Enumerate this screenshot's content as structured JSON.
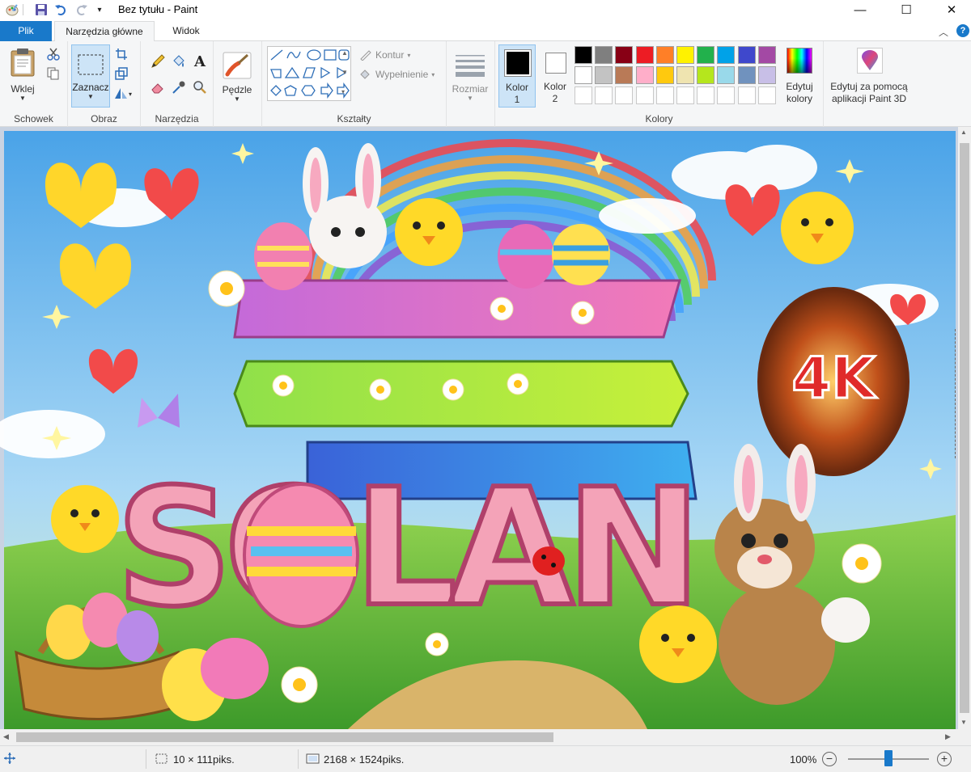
{
  "window": {
    "title": "Bez tytułu - Paint"
  },
  "tabs": {
    "file": "Plik",
    "home": "Narzędzia główne",
    "view": "Widok"
  },
  "ribbon": {
    "clipboard": {
      "paste": "Wklej",
      "label": "Schowek"
    },
    "image": {
      "select": "Zaznacz",
      "label": "Obraz"
    },
    "tools": {
      "label": "Narzędzia"
    },
    "brushes": {
      "label": "Pędzle"
    },
    "shapes": {
      "outline": "Kontur",
      "fill": "Wypełnienie",
      "label": "Kształty"
    },
    "size": {
      "label": "Rozmiar"
    },
    "colors": {
      "color1": "Kolor",
      "color1_num": "1",
      "color2": "Kolor",
      "color2_num": "2",
      "edit_line1": "Edytuj",
      "edit_line2": "kolory",
      "label": "Kolory",
      "primary": "#000000",
      "secondary": "#ffffff",
      "palette_row1": [
        "#000000",
        "#7f7f7f",
        "#880015",
        "#ed1c24",
        "#ff7f27",
        "#fff200",
        "#22b14c",
        "#00a2e8",
        "#3f48cc",
        "#a349a4"
      ],
      "palette_row2": [
        "#ffffff",
        "#c3c3c3",
        "#b97a57",
        "#ffaec9",
        "#ffc90e",
        "#efe4b0",
        "#b5e61d",
        "#99d9ea",
        "#7092be",
        "#c8bfe7"
      ]
    },
    "paint3d": {
      "line1": "Edytuj za pomocą",
      "line2": "aplikacji Paint 3D"
    }
  },
  "image": {
    "text": "SOLAN",
    "badge": "4K"
  },
  "status": {
    "selection_size": "10 × 111piks.",
    "image_size": "2168 × 1524piks.",
    "zoom": "100%",
    "zoom_level": 0.5
  }
}
